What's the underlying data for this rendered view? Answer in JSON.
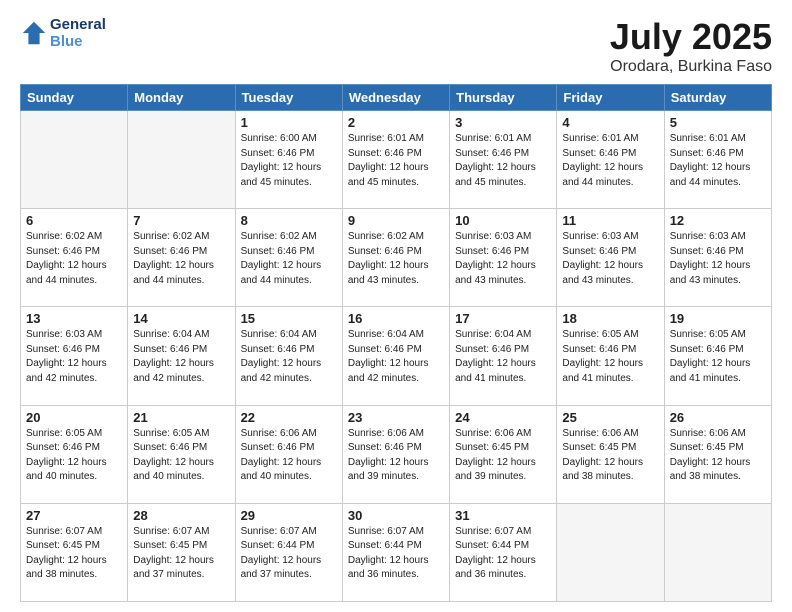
{
  "header": {
    "logo_line1": "General",
    "logo_line2": "Blue",
    "title": "July 2025",
    "subtitle": "Orodara, Burkina Faso"
  },
  "days_of_week": [
    "Sunday",
    "Monday",
    "Tuesday",
    "Wednesday",
    "Thursday",
    "Friday",
    "Saturday"
  ],
  "weeks": [
    [
      {
        "day": "",
        "info": ""
      },
      {
        "day": "",
        "info": ""
      },
      {
        "day": "1",
        "info": "Sunrise: 6:00 AM\nSunset: 6:46 PM\nDaylight: 12 hours and 45 minutes."
      },
      {
        "day": "2",
        "info": "Sunrise: 6:01 AM\nSunset: 6:46 PM\nDaylight: 12 hours and 45 minutes."
      },
      {
        "day": "3",
        "info": "Sunrise: 6:01 AM\nSunset: 6:46 PM\nDaylight: 12 hours and 45 minutes."
      },
      {
        "day": "4",
        "info": "Sunrise: 6:01 AM\nSunset: 6:46 PM\nDaylight: 12 hours and 44 minutes."
      },
      {
        "day": "5",
        "info": "Sunrise: 6:01 AM\nSunset: 6:46 PM\nDaylight: 12 hours and 44 minutes."
      }
    ],
    [
      {
        "day": "6",
        "info": "Sunrise: 6:02 AM\nSunset: 6:46 PM\nDaylight: 12 hours and 44 minutes."
      },
      {
        "day": "7",
        "info": "Sunrise: 6:02 AM\nSunset: 6:46 PM\nDaylight: 12 hours and 44 minutes."
      },
      {
        "day": "8",
        "info": "Sunrise: 6:02 AM\nSunset: 6:46 PM\nDaylight: 12 hours and 44 minutes."
      },
      {
        "day": "9",
        "info": "Sunrise: 6:02 AM\nSunset: 6:46 PM\nDaylight: 12 hours and 43 minutes."
      },
      {
        "day": "10",
        "info": "Sunrise: 6:03 AM\nSunset: 6:46 PM\nDaylight: 12 hours and 43 minutes."
      },
      {
        "day": "11",
        "info": "Sunrise: 6:03 AM\nSunset: 6:46 PM\nDaylight: 12 hours and 43 minutes."
      },
      {
        "day": "12",
        "info": "Sunrise: 6:03 AM\nSunset: 6:46 PM\nDaylight: 12 hours and 43 minutes."
      }
    ],
    [
      {
        "day": "13",
        "info": "Sunrise: 6:03 AM\nSunset: 6:46 PM\nDaylight: 12 hours and 42 minutes."
      },
      {
        "day": "14",
        "info": "Sunrise: 6:04 AM\nSunset: 6:46 PM\nDaylight: 12 hours and 42 minutes."
      },
      {
        "day": "15",
        "info": "Sunrise: 6:04 AM\nSunset: 6:46 PM\nDaylight: 12 hours and 42 minutes."
      },
      {
        "day": "16",
        "info": "Sunrise: 6:04 AM\nSunset: 6:46 PM\nDaylight: 12 hours and 42 minutes."
      },
      {
        "day": "17",
        "info": "Sunrise: 6:04 AM\nSunset: 6:46 PM\nDaylight: 12 hours and 41 minutes."
      },
      {
        "day": "18",
        "info": "Sunrise: 6:05 AM\nSunset: 6:46 PM\nDaylight: 12 hours and 41 minutes."
      },
      {
        "day": "19",
        "info": "Sunrise: 6:05 AM\nSunset: 6:46 PM\nDaylight: 12 hours and 41 minutes."
      }
    ],
    [
      {
        "day": "20",
        "info": "Sunrise: 6:05 AM\nSunset: 6:46 PM\nDaylight: 12 hours and 40 minutes."
      },
      {
        "day": "21",
        "info": "Sunrise: 6:05 AM\nSunset: 6:46 PM\nDaylight: 12 hours and 40 minutes."
      },
      {
        "day": "22",
        "info": "Sunrise: 6:06 AM\nSunset: 6:46 PM\nDaylight: 12 hours and 40 minutes."
      },
      {
        "day": "23",
        "info": "Sunrise: 6:06 AM\nSunset: 6:46 PM\nDaylight: 12 hours and 39 minutes."
      },
      {
        "day": "24",
        "info": "Sunrise: 6:06 AM\nSunset: 6:45 PM\nDaylight: 12 hours and 39 minutes."
      },
      {
        "day": "25",
        "info": "Sunrise: 6:06 AM\nSunset: 6:45 PM\nDaylight: 12 hours and 38 minutes."
      },
      {
        "day": "26",
        "info": "Sunrise: 6:06 AM\nSunset: 6:45 PM\nDaylight: 12 hours and 38 minutes."
      }
    ],
    [
      {
        "day": "27",
        "info": "Sunrise: 6:07 AM\nSunset: 6:45 PM\nDaylight: 12 hours and 38 minutes."
      },
      {
        "day": "28",
        "info": "Sunrise: 6:07 AM\nSunset: 6:45 PM\nDaylight: 12 hours and 37 minutes."
      },
      {
        "day": "29",
        "info": "Sunrise: 6:07 AM\nSunset: 6:44 PM\nDaylight: 12 hours and 37 minutes."
      },
      {
        "day": "30",
        "info": "Sunrise: 6:07 AM\nSunset: 6:44 PM\nDaylight: 12 hours and 36 minutes."
      },
      {
        "day": "31",
        "info": "Sunrise: 6:07 AM\nSunset: 6:44 PM\nDaylight: 12 hours and 36 minutes."
      },
      {
        "day": "",
        "info": ""
      },
      {
        "day": "",
        "info": ""
      }
    ]
  ]
}
